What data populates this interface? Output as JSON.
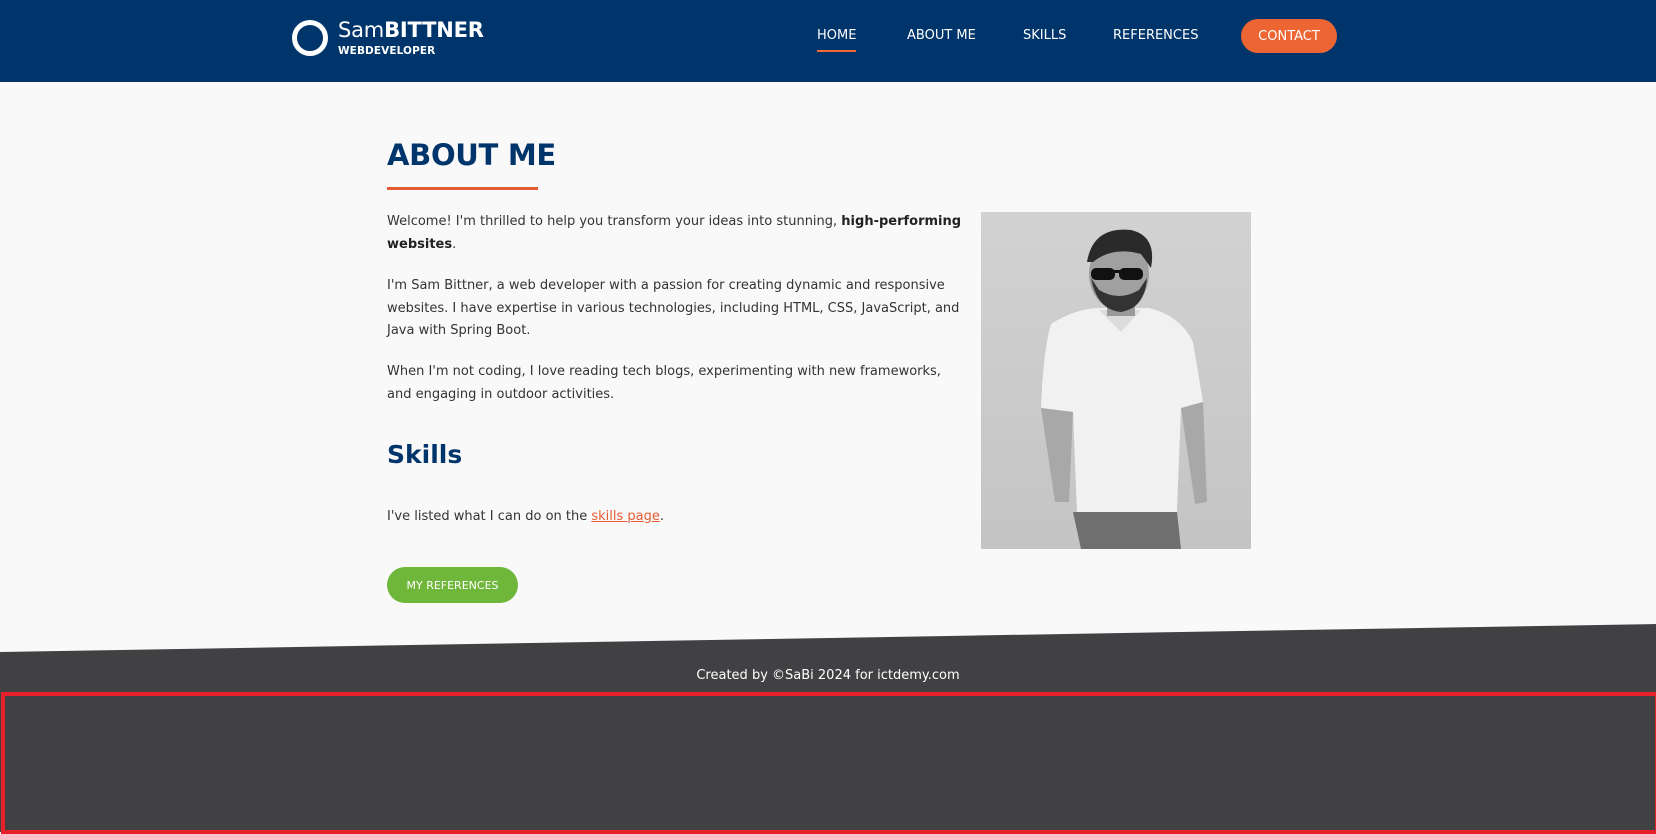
{
  "brand": {
    "name_first": "Sam",
    "name_last": "BITTNER",
    "subtitle": "WEBDEVELOPER"
  },
  "nav": {
    "items": [
      {
        "label": "HOME",
        "active": true
      },
      {
        "label": "ABOUT ME",
        "active": false
      },
      {
        "label": "SKILLS",
        "active": false
      },
      {
        "label": "REFERENCES",
        "active": false
      }
    ],
    "contact_label": "CONTACT"
  },
  "about": {
    "title": "ABOUT ME",
    "para1_text": "Welcome! I'm thrilled to help you transform your ideas into stunning, ",
    "para1_bold": "high-performing websites",
    "para1_end": ".",
    "para2": "I'm Sam Bittner, a web developer with a passion for creating dynamic and responsive websites. I have expertise in various technologies, including HTML, CSS, JavaScript, and Java with Spring Boot.",
    "para3": "When I'm not coding, I love reading tech blogs, experimenting with new frameworks, and engaging in outdoor activities."
  },
  "skills": {
    "title": "Skills",
    "text_before": "I've listed what I can do on the ",
    "link_label": "skills page",
    "text_after": "."
  },
  "buttons": {
    "references_label": "MY REFERENCES"
  },
  "footer": {
    "credit": "Created by ©SaBi 2024 for ictdemy.com"
  },
  "colors": {
    "header_bg": "#00356b",
    "accent_orange": "#ee6534",
    "green_button": "#6fb73b",
    "footer_bg": "#414144",
    "highlight_border": "#e8202a"
  },
  "icons": {
    "logo": "ring-logo-icon"
  }
}
